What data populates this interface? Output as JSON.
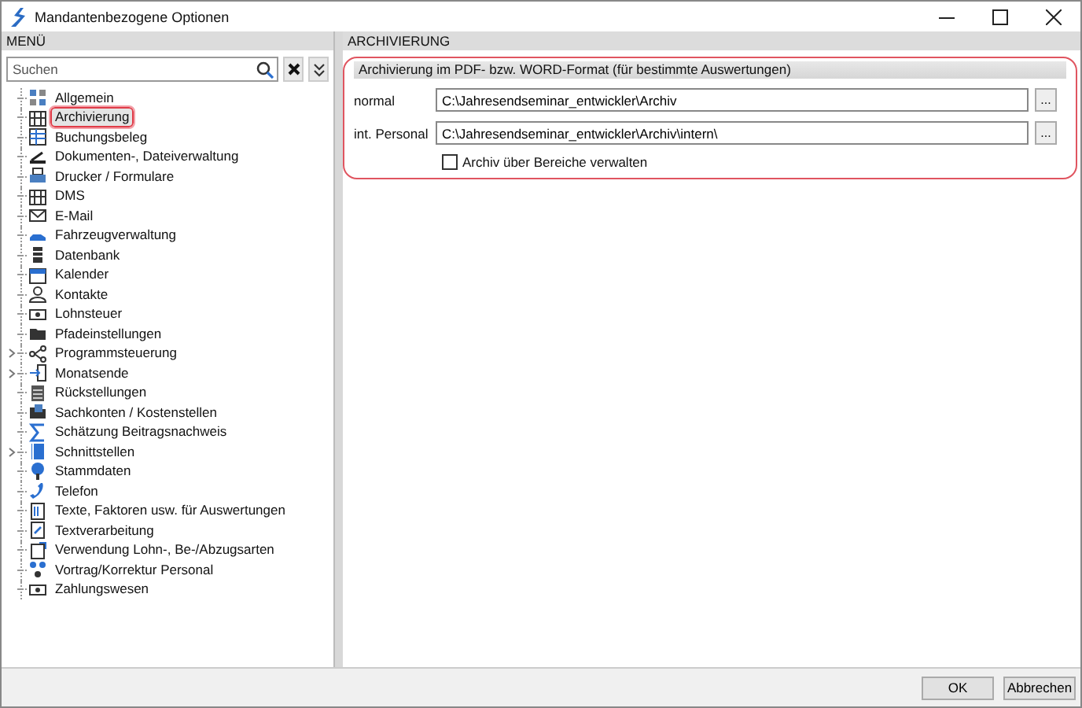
{
  "window": {
    "title": "Mandantenbezogene Optionen"
  },
  "menu": {
    "header": "MENÜ",
    "search": {
      "placeholder": "Suchen"
    },
    "items": [
      {
        "label": "Allgemein",
        "selected": false,
        "has_children": false
      },
      {
        "label": "Archivierung",
        "selected": true,
        "has_children": false
      },
      {
        "label": "Buchungsbeleg",
        "selected": false,
        "has_children": false
      },
      {
        "label": "Dokumenten-, Dateiverwaltung",
        "selected": false,
        "has_children": false
      },
      {
        "label": "Drucker / Formulare",
        "selected": false,
        "has_children": false
      },
      {
        "label": "DMS",
        "selected": false,
        "has_children": false
      },
      {
        "label": "E-Mail",
        "selected": false,
        "has_children": false
      },
      {
        "label": "Fahrzeugverwaltung",
        "selected": false,
        "has_children": false
      },
      {
        "label": "Datenbank",
        "selected": false,
        "has_children": false
      },
      {
        "label": "Kalender",
        "selected": false,
        "has_children": false
      },
      {
        "label": "Kontakte",
        "selected": false,
        "has_children": false
      },
      {
        "label": "Lohnsteuer",
        "selected": false,
        "has_children": false
      },
      {
        "label": "Pfadeinstellungen",
        "selected": false,
        "has_children": false
      },
      {
        "label": "Programmsteuerung",
        "selected": false,
        "has_children": true
      },
      {
        "label": "Monatsende",
        "selected": false,
        "has_children": true
      },
      {
        "label": "Rückstellungen",
        "selected": false,
        "has_children": false
      },
      {
        "label": "Sachkonten / Kostenstellen",
        "selected": false,
        "has_children": false
      },
      {
        "label": "Schätzung Beitragsnachweis",
        "selected": false,
        "has_children": false
      },
      {
        "label": "Schnittstellen",
        "selected": false,
        "has_children": true
      },
      {
        "label": "Stammdaten",
        "selected": false,
        "has_children": false
      },
      {
        "label": "Telefon",
        "selected": false,
        "has_children": false
      },
      {
        "label": "Texte, Faktoren usw. für Auswertungen",
        "selected": false,
        "has_children": false
      },
      {
        "label": "Textverarbeitung",
        "selected": false,
        "has_children": false
      },
      {
        "label": "Verwendung Lohn-, Be-/Abzugsarten",
        "selected": false,
        "has_children": false
      },
      {
        "label": "Vortrag/Korrektur Personal",
        "selected": false,
        "has_children": false
      },
      {
        "label": "Zahlungswesen",
        "selected": false,
        "has_children": false
      }
    ]
  },
  "content": {
    "header": "ARCHIVIERUNG",
    "group": {
      "title": "Archivierung  im PDF- bzw. WORD-Format  (für bestimmte Auswertungen)",
      "highlighted": true,
      "fields": [
        {
          "label": "normal",
          "value": "C:\\Jahresendseminar_entwickler\\Archiv",
          "browse": "..."
        },
        {
          "label": "int. Personal",
          "value": "C:\\Jahresendseminar_entwickler\\Archiv\\intern\\",
          "browse": "..."
        }
      ],
      "checkbox": {
        "label": "Archiv über Bereiche verwalten",
        "checked": false
      }
    }
  },
  "buttons": [
    "OK",
    "Abbrechen"
  ]
}
